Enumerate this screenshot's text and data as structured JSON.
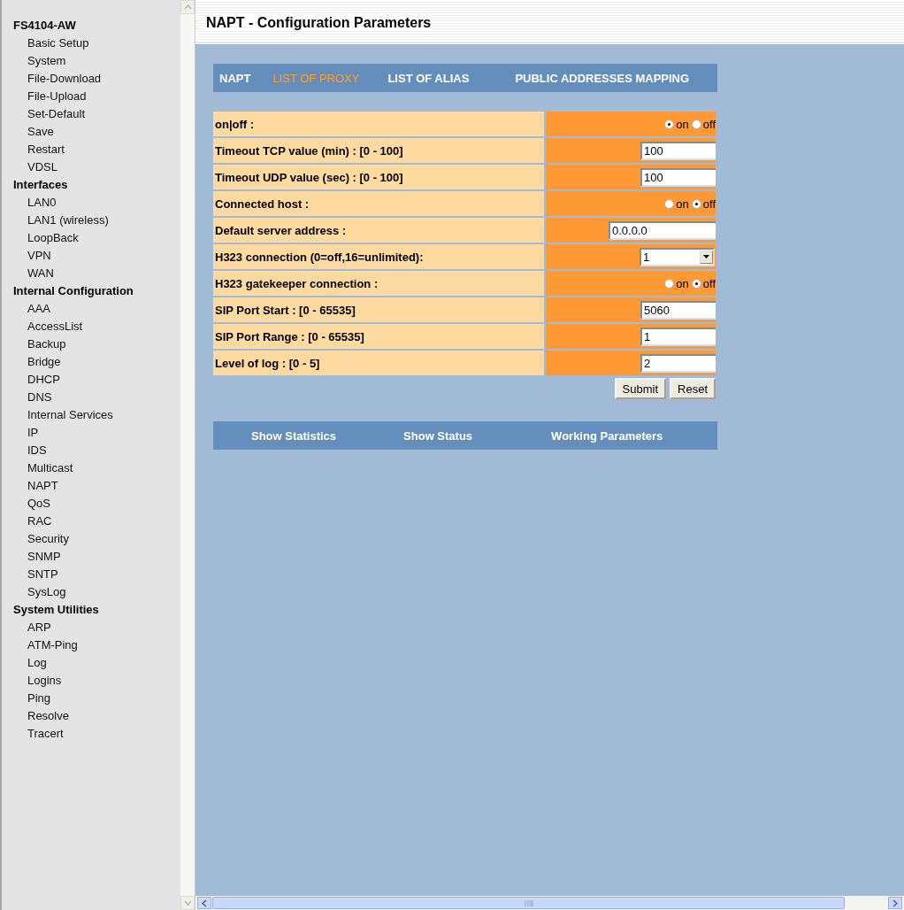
{
  "sidebar": {
    "sections": [
      {
        "title": "FS4104-AW",
        "items": [
          "Basic Setup",
          "System",
          "File-Download",
          "File-Upload",
          "Set-Default",
          "Save",
          "Restart",
          "VDSL"
        ]
      },
      {
        "title": "Interfaces",
        "items": [
          "LAN0",
          "LAN1 (wireless)",
          "LoopBack",
          "VPN",
          "WAN"
        ]
      },
      {
        "title": "Internal Configuration",
        "items": [
          "AAA",
          "AccessList",
          "Backup",
          "Bridge",
          "DHCP",
          "DNS",
          "Internal Services",
          "IP",
          "IDS",
          "Multicast",
          "NAPT",
          "QoS",
          "RAC",
          "Security",
          "SNMP",
          "SNTP",
          "SysLog"
        ]
      },
      {
        "title": "System Utilities",
        "items": [
          "ARP",
          "ATM-Ping",
          "Log",
          "Logins",
          "Ping",
          "Resolve",
          "Tracert"
        ]
      }
    ]
  },
  "page_title": "NAPT - Configuration Parameters",
  "tabs": [
    {
      "label": "NAPT",
      "selected": false
    },
    {
      "label": "LIST OF PROXY",
      "selected": true
    },
    {
      "label": "LIST OF ALIAS",
      "selected": false
    },
    {
      "label": "PUBLIC ADDRESSES MAPPING",
      "selected": false
    }
  ],
  "form": {
    "rows": [
      {
        "kind": "radio",
        "label": "on|off :",
        "options": [
          {
            "label": "on",
            "selected": true
          },
          {
            "label": "off",
            "selected": false
          }
        ]
      },
      {
        "kind": "text",
        "label": "Timeout TCP value (min) : [0 - 100]",
        "value": "100"
      },
      {
        "kind": "text",
        "label": "Timeout UDP value (sec) : [0 - 100]",
        "value": "100"
      },
      {
        "kind": "radio",
        "label": "Connected host :",
        "options": [
          {
            "label": "on",
            "selected": false
          },
          {
            "label": "off",
            "selected": true
          }
        ]
      },
      {
        "kind": "wide_text",
        "label": "Default server address :",
        "value": "0.0.0.0"
      },
      {
        "kind": "select",
        "label": "H323 connection (0=off,16=unlimited):",
        "value": "1"
      },
      {
        "kind": "radio",
        "label": "H323 gatekeeper connection :",
        "options": [
          {
            "label": "on",
            "selected": false
          },
          {
            "label": "off",
            "selected": true
          }
        ]
      },
      {
        "kind": "text",
        "label": "SIP Port Start : [0 - 65535]",
        "value": "5060"
      },
      {
        "kind": "text",
        "label": "SIP Port Range : [0 - 65535]",
        "value": "1"
      },
      {
        "kind": "text",
        "label": "Level of log : [0 - 5]",
        "value": "2"
      }
    ],
    "buttons": [
      "Submit",
      "Reset"
    ]
  },
  "bottom_links": [
    "Show Statistics",
    "Show Status",
    "Working Parameters"
  ]
}
